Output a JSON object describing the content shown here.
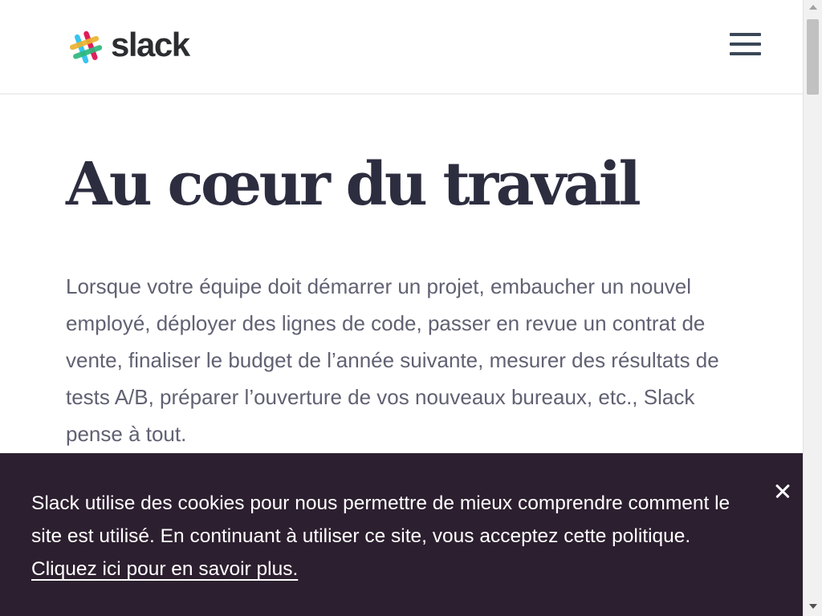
{
  "header": {
    "logo_text": "slack",
    "logo_colors": [
      "#36c5f0",
      "#2eb67d",
      "#ecb22e",
      "#e01e5a"
    ],
    "menu_icon": "hamburger-menu-icon"
  },
  "hero": {
    "title": "Au cœur du travail",
    "body": "Lorsque votre équipe doit démarrer un projet, embaucher un nouvel employé, déployer des lignes de code, passer en revue un contrat de vente, finaliser le budget de l’année suivante, mesurer des résultats de tests A/B, préparer l’ouverture de vos nouveaux bureaux, etc., Slack pense à tout."
  },
  "cookie_banner": {
    "text": "Slack utilise des cookies pour nous permettre de mieux comprendre comment le site est utilisé. En continuant à utiliser ce site, vous acceptez cette politique.",
    "link_text": "Cliquez ici pour en savoir plus.",
    "close_icon": "close-icon",
    "background_color": "#2c1f2f"
  },
  "colors": {
    "title": "#2c2d3f",
    "body_text": "#616173",
    "menu_icon": "#3a4756"
  }
}
